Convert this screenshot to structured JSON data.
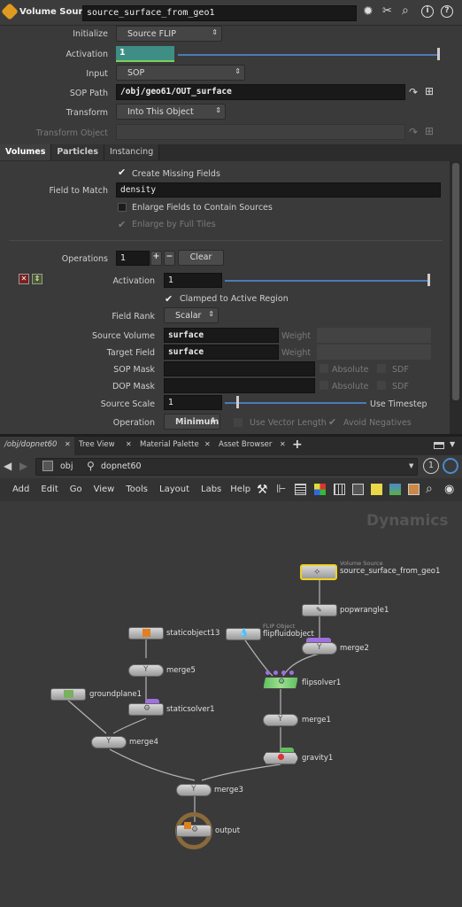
{
  "header": {
    "title": "Volume Source",
    "node_name": "source_surface_from_geo1"
  },
  "params": {
    "initialize": {
      "label": "Initialize",
      "value": "Source FLIP"
    },
    "activation": {
      "label": "Activation",
      "value": "1"
    },
    "input": {
      "label": "Input",
      "value": "SOP"
    },
    "sop_path": {
      "label": "SOP Path",
      "value": "/obj/geo61/OUT_surface"
    },
    "transform": {
      "label": "Transform",
      "value": "Into This Object"
    },
    "transform_object": {
      "label": "Transform Object",
      "value": ""
    }
  },
  "tabs": [
    "Volumes",
    "Particles",
    "Instancing"
  ],
  "volumes": {
    "create_missing": "Create Missing Fields",
    "field_to_match_label": "Field to Match",
    "field_to_match": "density",
    "enlarge_fields": "Enlarge Fields to Contain Sources",
    "enlarge_full": "Enlarge by Full Tiles",
    "operations_label": "Operations",
    "operations_value": "1",
    "plus": "+",
    "minus": "−",
    "clear": "Clear",
    "op_activation_label": "Activation",
    "op_activation_value": "1",
    "clamped": "Clamped to Active Region",
    "field_rank_label": "Field Rank",
    "field_rank": "Scalar",
    "source_volume_label": "Source Volume",
    "source_volume": "surface",
    "target_field_label": "Target Field",
    "target_field": "surface",
    "weight_label": "Weight",
    "sop_mask_label": "SOP Mask",
    "dop_mask_label": "DOP Mask",
    "absolute_label": "Absolute",
    "sdf_label": "SDF",
    "source_scale_label": "Source Scale",
    "source_scale": "1",
    "use_timestep": "Use Timestep",
    "operation_label": "Operation",
    "operation": "Minimum",
    "use_vector_length": "Use Vector Length",
    "avoid_negatives": "Avoid Negatives"
  },
  "pane_tabs": [
    "/obj/dopnet60",
    "Tree View",
    "Material Palette",
    "Asset Browser"
  ],
  "path": {
    "obj": "obj",
    "net": "dopnet60",
    "badge": "1"
  },
  "menu": [
    "Add",
    "Edit",
    "Go",
    "View",
    "Tools",
    "Layout",
    "Labs",
    "Help"
  ],
  "network": {
    "context": "Dynamics",
    "nodes": [
      {
        "name": "source_surface_from_geo1",
        "type": "Volume Source"
      },
      {
        "name": "popwrangle1",
        "type": ""
      },
      {
        "name": "merge2",
        "type": ""
      },
      {
        "name": "flipfluidobject",
        "type": "FLIP Object"
      },
      {
        "name": "flipsolver1",
        "type": ""
      },
      {
        "name": "merge1",
        "type": ""
      },
      {
        "name": "gravity1",
        "type": ""
      },
      {
        "name": "staticobject13",
        "type": ""
      },
      {
        "name": "merge5",
        "type": ""
      },
      {
        "name": "groundplane1",
        "type": ""
      },
      {
        "name": "staticsolver1",
        "type": ""
      },
      {
        "name": "merge4",
        "type": ""
      },
      {
        "name": "merge3",
        "type": ""
      },
      {
        "name": "output",
        "type": ""
      }
    ]
  }
}
